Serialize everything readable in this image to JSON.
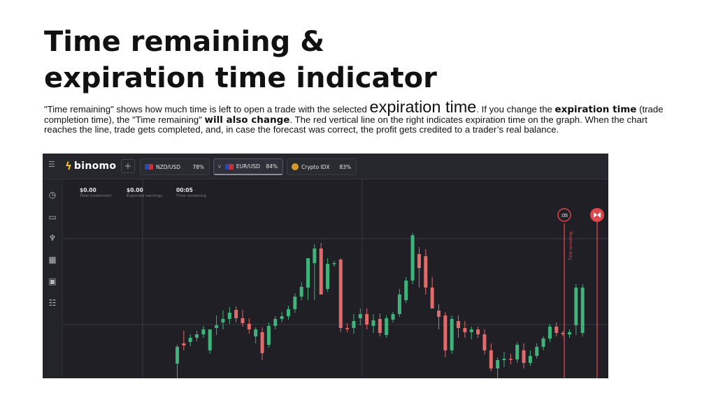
{
  "slide": {
    "title_line1": "Time remaining &",
    "title_line2": "expiration time indicator",
    "p_part1": "\"Time remaining\" shows how much time is left to open a trade with the selected ",
    "p_big": "expiration time",
    "p_part2": ". If you change the ",
    "p_bold1": "expiration time",
    "p_part3": " (trade completion time), the \"Time remaining\" ",
    "p_bold2": "will also change",
    "p_part4": ". The red vertical line on the right  indicates expiration time on the graph. When the chart reaches the line, trade gets completed, and, in case the forecast was correct, the profit gets credited to a trader’s real balance."
  },
  "app": {
    "logo_text": "binomo",
    "add_label": "+",
    "tabs": [
      {
        "name": "NZD/USD",
        "pct": "78%"
      },
      {
        "name": "EUR/USD",
        "pct": "84%"
      },
      {
        "name": "Crypto IDX",
        "pct": "83%"
      }
    ],
    "sidebar_icons": [
      "clock-icon",
      "chart-icon",
      "trophy-icon",
      "calendar-icon",
      "gift-icon",
      "settings-sliders-icon"
    ],
    "stats": [
      {
        "value": "$0.00",
        "label": "Total investment"
      },
      {
        "value": "$0.00",
        "label": "Expected earnings"
      },
      {
        "value": "00:05",
        "label": "Time remaining"
      }
    ],
    "marker_time": ":05",
    "marker_vertical_label": "Time remaining",
    "expiry_marker_icon": "expiry-flag-icon",
    "colors": {
      "background": "#1f1f25",
      "up": "#3fb37a",
      "down": "#e06b6b",
      "expiry_line": "#e0474c"
    }
  },
  "chart_data": {
    "type": "candlestick",
    "candles": [
      {
        "o": 21,
        "h": 48,
        "l": 0,
        "c": 45
      },
      {
        "o": 50,
        "h": 68,
        "l": 40,
        "c": 47
      },
      {
        "o": 52,
        "h": 63,
        "l": 46,
        "c": 58
      },
      {
        "o": 58,
        "h": 68,
        "l": 53,
        "c": 63
      },
      {
        "o": 63,
        "h": 75,
        "l": 58,
        "c": 70
      },
      {
        "o": 40,
        "h": 62,
        "l": 35,
        "c": 70
      },
      {
        "o": 72,
        "h": 90,
        "l": 62,
        "c": 76
      },
      {
        "o": 80,
        "h": 97,
        "l": 70,
        "c": 85
      },
      {
        "o": 85,
        "h": 102,
        "l": 78,
        "c": 94
      },
      {
        "o": 98,
        "h": 103,
        "l": 80,
        "c": 86
      },
      {
        "o": 86,
        "h": 98,
        "l": 74,
        "c": 79
      },
      {
        "o": 78,
        "h": 86,
        "l": 64,
        "c": 70
      },
      {
        "o": 60,
        "h": 73,
        "l": 50,
        "c": 70
      },
      {
        "o": 66,
        "h": 73,
        "l": 26,
        "c": 36
      },
      {
        "o": 48,
        "h": 80,
        "l": 44,
        "c": 75
      },
      {
        "o": 75,
        "h": 89,
        "l": 70,
        "c": 85
      },
      {
        "o": 85,
        "h": 95,
        "l": 80,
        "c": 89
      },
      {
        "o": 89,
        "h": 104,
        "l": 84,
        "c": 99
      },
      {
        "o": 99,
        "h": 122,
        "l": 94,
        "c": 117
      },
      {
        "o": 117,
        "h": 138,
        "l": 112,
        "c": 131
      },
      {
        "o": 130,
        "h": 172,
        "l": 112,
        "c": 172
      },
      {
        "o": 165,
        "h": 192,
        "l": 112,
        "c": 186
      },
      {
        "o": 186,
        "h": 194,
        "l": 120,
        "c": 120
      },
      {
        "o": 128,
        "h": 172,
        "l": 124,
        "c": 164
      },
      {
        "o": 165,
        "h": 168,
        "l": 160,
        "c": 165
      },
      {
        "o": 170,
        "h": 172,
        "l": 66,
        "c": 72
      },
      {
        "o": 72,
        "h": 79,
        "l": 66,
        "c": 71
      },
      {
        "o": 72,
        "h": 92,
        "l": 64,
        "c": 82
      },
      {
        "o": 86,
        "h": 100,
        "l": 76,
        "c": 92
      },
      {
        "o": 92,
        "h": 100,
        "l": 70,
        "c": 77
      },
      {
        "o": 75,
        "h": 92,
        "l": 65,
        "c": 83
      },
      {
        "o": 85,
        "h": 93,
        "l": 60,
        "c": 65
      },
      {
        "o": 62,
        "h": 90,
        "l": 58,
        "c": 86
      },
      {
        "o": 84,
        "h": 95,
        "l": 80,
        "c": 92
      },
      {
        "o": 92,
        "h": 128,
        "l": 88,
        "c": 120
      },
      {
        "o": 112,
        "h": 145,
        "l": 108,
        "c": 140
      },
      {
        "o": 140,
        "h": 208,
        "l": 135,
        "c": 205
      },
      {
        "o": 178,
        "h": 188,
        "l": 130,
        "c": 158
      },
      {
        "o": 175,
        "h": 185,
        "l": 120,
        "c": 130
      },
      {
        "o": 130,
        "h": 145,
        "l": 100,
        "c": 100
      },
      {
        "o": 97,
        "h": 106,
        "l": 70,
        "c": 88
      },
      {
        "o": 90,
        "h": 95,
        "l": 30,
        "c": 40
      },
      {
        "o": 40,
        "h": 90,
        "l": 35,
        "c": 85
      },
      {
        "o": 82,
        "h": 90,
        "l": 58,
        "c": 72
      },
      {
        "o": 72,
        "h": 82,
        "l": 58,
        "c": 66
      },
      {
        "o": 66,
        "h": 74,
        "l": 56,
        "c": 70
      },
      {
        "o": 70,
        "h": 74,
        "l": 58,
        "c": 63
      },
      {
        "o": 63,
        "h": 70,
        "l": 34,
        "c": 40
      },
      {
        "o": 40,
        "h": 50,
        "l": 10,
        "c": 14
      },
      {
        "o": 14,
        "h": 30,
        "l": 0,
        "c": 26
      },
      {
        "o": 26,
        "h": 38,
        "l": 16,
        "c": 28
      },
      {
        "o": 28,
        "h": 35,
        "l": 20,
        "c": 27
      },
      {
        "o": 27,
        "h": 52,
        "l": 22,
        "c": 48
      },
      {
        "o": 40,
        "h": 50,
        "l": 14,
        "c": 22
      },
      {
        "o": 22,
        "h": 40,
        "l": 18,
        "c": 32
      },
      {
        "o": 32,
        "h": 50,
        "l": 28,
        "c": 45
      },
      {
        "o": 45,
        "h": 60,
        "l": 40,
        "c": 57
      },
      {
        "o": 57,
        "h": 78,
        "l": 52,
        "c": 74
      },
      {
        "o": 74,
        "h": 80,
        "l": 60,
        "c": 65
      },
      {
        "o": 65,
        "h": 68,
        "l": 60,
        "c": 63
      },
      {
        "o": 63,
        "h": 70,
        "l": 58,
        "c": 66
      },
      {
        "o": 76,
        "h": 135,
        "l": 62,
        "c": 130
      },
      {
        "o": 65,
        "h": 135,
        "l": 60,
        "c": 130
      }
    ]
  }
}
